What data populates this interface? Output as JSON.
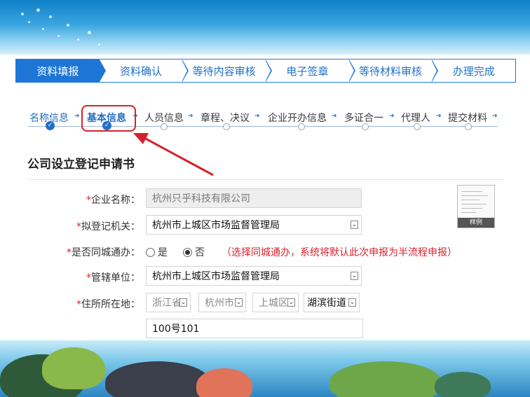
{
  "steps": [
    {
      "label": "资料填报"
    },
    {
      "label": "资料确认"
    },
    {
      "label": "等待内容审核"
    },
    {
      "label": "电子签章"
    },
    {
      "label": "等待材料审核"
    },
    {
      "label": "办理完成"
    }
  ],
  "substeps": [
    {
      "label": "名称信息"
    },
    {
      "label": "基本信息"
    },
    {
      "label": "人员信息"
    },
    {
      "label": "章程、决议"
    },
    {
      "label": "企业开办信息"
    },
    {
      "label": "多证合一"
    },
    {
      "label": "代理人"
    },
    {
      "label": "提交材料"
    }
  ],
  "form": {
    "title": "公司设立登记申请书",
    "req_mark": "*",
    "company_name_label": "企业名称：",
    "company_name_value": "杭州只乎科技有限公司",
    "reg_authority_label": "拟登记机关：",
    "reg_authority_value": "杭州市上城区市场监督管理局",
    "same_city_label": "是否同城通办：",
    "yes_label": "是",
    "no_label": "否",
    "same_city_hint": "（选择同城通办，系统将默认此次申报为半流程申报）",
    "jurisdiction_label": "管辖单位：",
    "jurisdiction_value": "杭州市上城区市场监督管理局",
    "address_label": "住所所在地：",
    "province": "浙江省",
    "city": "杭州市",
    "district": "上城区",
    "street": "湖滨街道",
    "address_detail": "100号101",
    "sample_tag": "样例"
  },
  "colors": {
    "accent": "#1d76d6",
    "required": "#d5232d"
  }
}
